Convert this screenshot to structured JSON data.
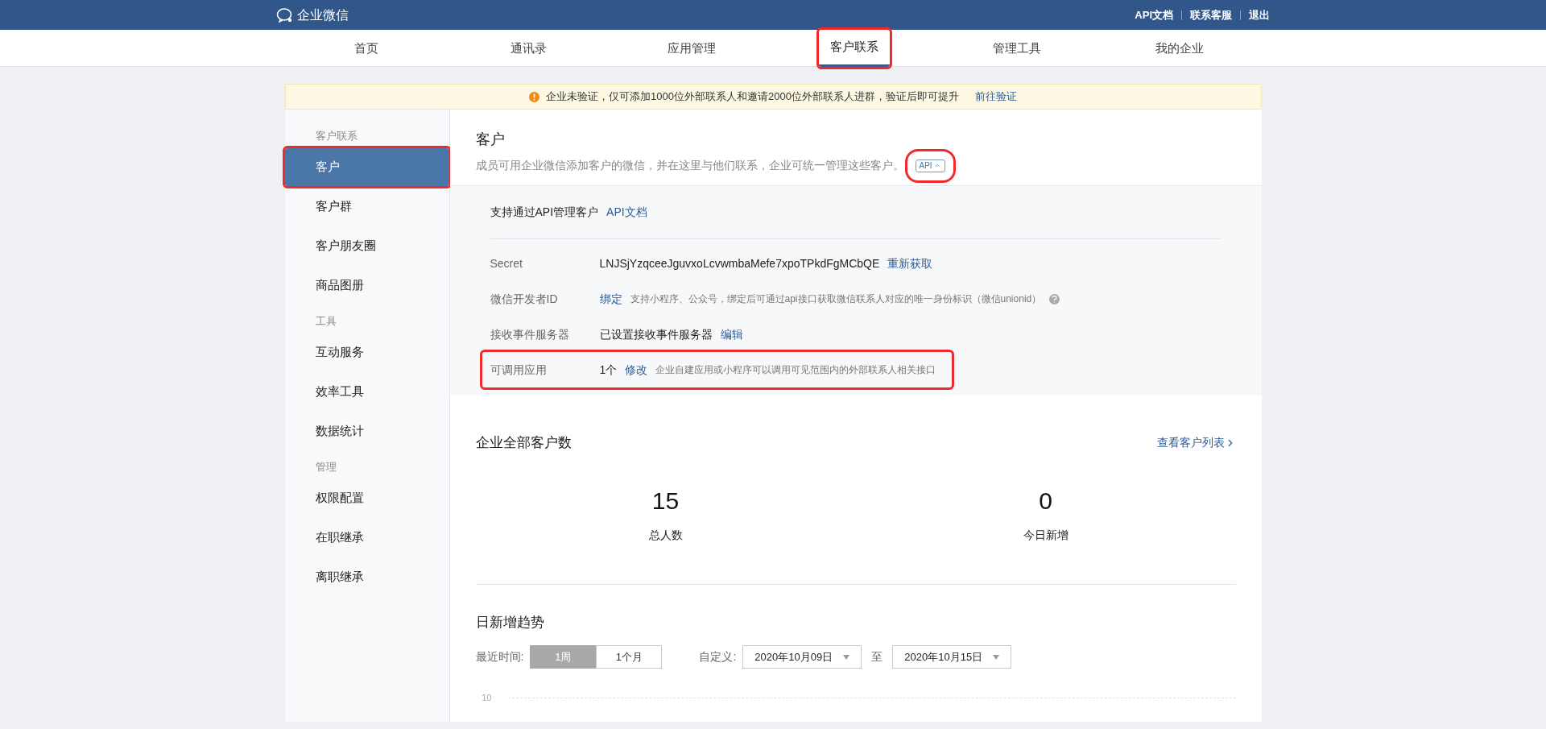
{
  "top_bar": {
    "logo_text": "企业微信",
    "links": [
      "API文档",
      "联系客服",
      "退出"
    ]
  },
  "nav_tabs": [
    {
      "label": "首页",
      "selected": false,
      "highlighted": false
    },
    {
      "label": "通讯录",
      "selected": false,
      "highlighted": false
    },
    {
      "label": "应用管理",
      "selected": false,
      "highlighted": false
    },
    {
      "label": "客户联系",
      "selected": true,
      "highlighted": true
    },
    {
      "label": "管理工具",
      "selected": false,
      "highlighted": false
    },
    {
      "label": "我的企业",
      "selected": false,
      "highlighted": false
    }
  ],
  "notice": {
    "text": "企业未验证，仅可添加1000位外部联系人和邀请2000位外部联系人进群，验证后即可提升",
    "link": "前往验证"
  },
  "sidebar": {
    "sections": [
      {
        "title": "客户联系",
        "items": [
          {
            "label": "客户",
            "selected": true,
            "highlighted": true
          },
          {
            "label": "客户群",
            "selected": false,
            "highlighted": false
          },
          {
            "label": "客户朋友圈",
            "selected": false,
            "highlighted": false
          },
          {
            "label": "商品图册",
            "selected": false,
            "highlighted": false
          }
        ]
      },
      {
        "title": "工具",
        "items": [
          {
            "label": "互动服务",
            "selected": false,
            "highlighted": false
          },
          {
            "label": "效率工具",
            "selected": false,
            "highlighted": false
          },
          {
            "label": "数据统计",
            "selected": false,
            "highlighted": false
          }
        ]
      },
      {
        "title": "管理",
        "items": [
          {
            "label": "权限配置",
            "selected": false,
            "highlighted": false
          },
          {
            "label": "在职继承",
            "selected": false,
            "highlighted": false
          },
          {
            "label": "离职继承",
            "selected": false,
            "highlighted": false
          }
        ]
      }
    ]
  },
  "customer": {
    "title": "客户",
    "description": "成员可用企业微信添加客户的微信，并在这里与他们联系，企业可统一管理这些客户。",
    "api_toggle": {
      "label": "API",
      "expanded": true,
      "highlighted": true
    },
    "api_panel": {
      "intro": "支持通过API管理客户",
      "intro_link": "API文档",
      "rows": [
        {
          "label": "Secret",
          "highlighted": false,
          "parts": [
            {
              "kind": "value",
              "text": "LNJSjYzqceeJguvxoLcvwmbaMefe7xpoTPkdFgMCbQE"
            },
            {
              "kind": "link",
              "text": "重新获取"
            }
          ]
        },
        {
          "label": "微信开发者ID",
          "highlighted": false,
          "parts": [
            {
              "kind": "link",
              "text": "绑定"
            },
            {
              "kind": "hint",
              "text": "支持小程序、公众号，绑定后可通过api接口获取微信联系人对应的唯一身份标识（微信unionid）"
            },
            {
              "kind": "help"
            }
          ]
        },
        {
          "label": "接收事件服务器",
          "highlighted": false,
          "parts": [
            {
              "kind": "value",
              "text": "已设置接收事件服务器"
            },
            {
              "kind": "link",
              "text": "编辑"
            }
          ]
        },
        {
          "label": "可调用应用",
          "highlighted": true,
          "parts": [
            {
              "kind": "value",
              "text": "1个"
            },
            {
              "kind": "link",
              "text": "修改"
            },
            {
              "kind": "hint",
              "text": "企业自建应用或小程序可以调用可见范围内的外部联系人相关接口"
            }
          ]
        }
      ]
    }
  },
  "stats": {
    "title": "企业全部客户数",
    "link": "查看客户列表",
    "metrics": [
      {
        "value": "15",
        "label": "总人数"
      },
      {
        "value": "0",
        "label": "今日新增"
      }
    ]
  },
  "trend": {
    "title": "日新增趋势",
    "range_label": "最近时间:",
    "ranges": [
      {
        "label": "1周",
        "selected": true
      },
      {
        "label": "1个月",
        "selected": false
      }
    ],
    "custom_label": "自定义:",
    "start_date": "2020年10月09日",
    "to_label": "至",
    "end_date": "2020年10月15日",
    "y_axis_label": "10"
  }
}
